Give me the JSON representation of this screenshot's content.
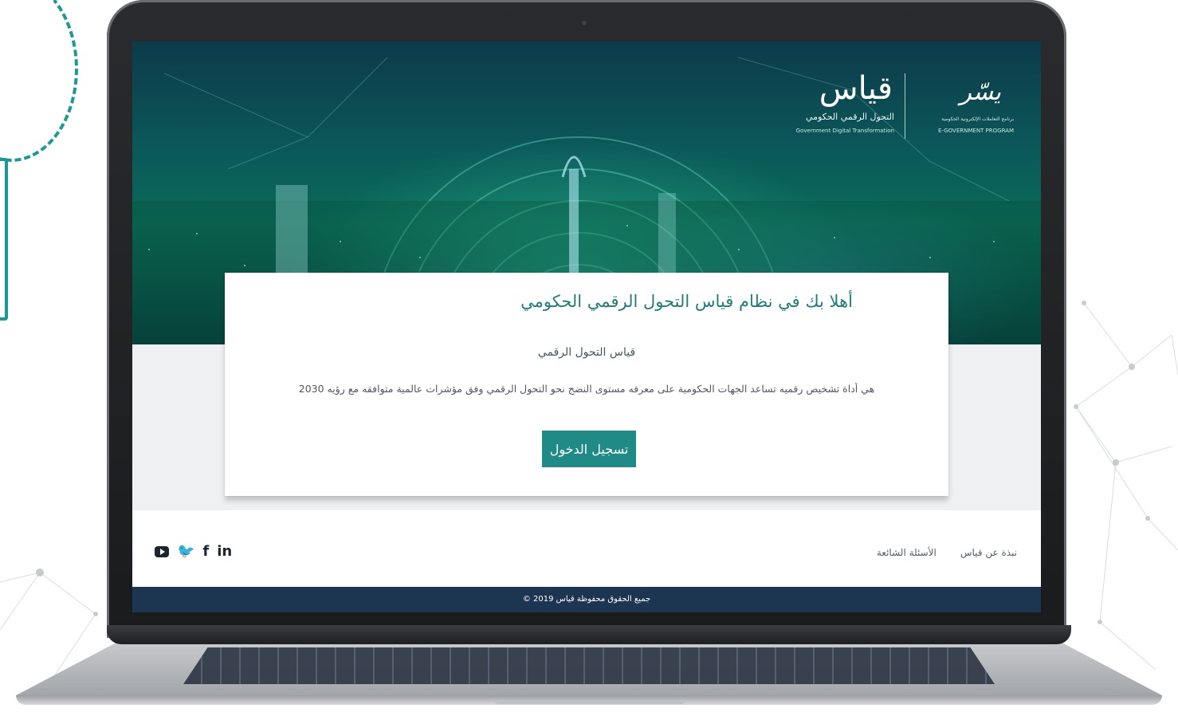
{
  "hero": {
    "logo": {
      "qiyas_title": "قياس",
      "qiyas_subtitle_ar": "التحول الرقمي الحكومي",
      "qiyas_subtitle_en": "Government Digital Transformation",
      "yesser_mark": "يسّر",
      "yesser_subtitle_ar": "برنامج التعاملات الإلكترونية الحكومية",
      "yesser_subtitle_en": "E-GOVERNMENT PROGRAM"
    }
  },
  "card": {
    "title": "أهلا بك في نظام قياس التحول الرقمي الحكومي",
    "subtitle": "قياس التحول الرقمي",
    "description": "هي أداة تشخيص رقميه تساعد الجهات الحكومية على معرفه مستوى النضج نحو التحول الرقمي وفق مؤشرات عالمية متوافقه مع رؤيه 2030",
    "login_label": "تسجيل الدخول"
  },
  "footer": {
    "nav": [
      {
        "label": "نبذة عن قياس"
      },
      {
        "label": "الأسئلة الشائعة"
      }
    ],
    "social": [
      {
        "label": "in",
        "icon": "linkedin-icon"
      },
      {
        "label": "f",
        "icon": "facebook-icon"
      },
      {
        "label": "🐦",
        "icon": "twitter-icon"
      },
      {
        "label": "",
        "icon": "youtube-icon"
      }
    ],
    "copyright": "جميع الحقوق محفوظة قياس 2019 ©"
  },
  "colors": {
    "accent": "#1f8a86",
    "footer_bar": "#1c3550",
    "title_text": "#1f7d7b",
    "decoration": "#1a9a93"
  }
}
